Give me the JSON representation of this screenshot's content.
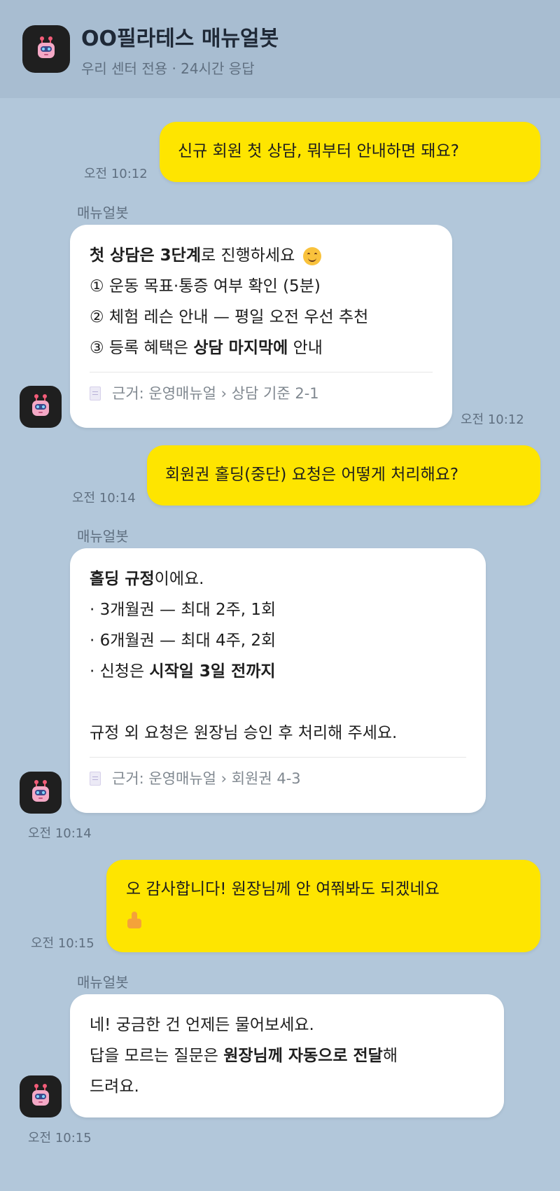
{
  "header": {
    "title": "OO필라테스 매뉴얼봇",
    "subtitle": "우리 센터 전용 · 24시간 응답",
    "avatar_icon": "robot-icon"
  },
  "messages": [
    {
      "from": "user",
      "text": "신규 회원 첫 상담, 뭐부터 안내하면 돼요?",
      "time": "오전 10:12"
    },
    {
      "from": "bot",
      "sender": "매뉴얼봇",
      "time": "오전 10:12",
      "lines": [
        {
          "b1": "첫 상담은 3단계",
          "t1": "로 진행하세요"
        },
        {
          "t1": "① 운동 목표·통증 여부 확인 (5분)"
        },
        {
          "t1": "② 체험 레슨 안내 — 평일 오전 우선 추천"
        },
        {
          "t1": "③ 등록 혜택은 ",
          "b1": "상담 마지막에",
          "t2": " 안내"
        }
      ],
      "source": "근거: 운영매뉴얼 › 상담 기준 2-1"
    },
    {
      "from": "user",
      "text": "회원권 홀딩(중단) 요청은 어떻게 처리해요?",
      "time": "오전 10:14"
    },
    {
      "from": "bot",
      "sender": "매뉴얼봇",
      "time": "오전 10:14",
      "lines": [
        {
          "b1": "홀딩 규정",
          "t1": "이에요."
        },
        {
          "t1": "· 3개월권 — 최대 2주, 1회"
        },
        {
          "t1": "· 6개월권 — 최대 4주, 2회"
        },
        {
          "t1": "· 신청은 ",
          "b1": "시작일 3일 전까지"
        },
        {
          "t1": ""
        },
        {
          "t1": "규정 외 요청은 원장님 승인 후 처리해 주세요."
        }
      ],
      "source": "근거: 운영매뉴얼 › 회원권 4-3"
    },
    {
      "from": "user",
      "text_line1": "오 감사합니다! 원장님께 안 여쭤봐도 되겠네요",
      "time": "오전 10:15"
    },
    {
      "from": "bot",
      "sender": "매뉴얼봇",
      "time": "오전 10:15",
      "lines": [
        {
          "t1": "네! 궁금한 건 언제든 물어보세요."
        },
        {
          "t1": "답을 모르는 질문은 ",
          "b1": "원장님께 자동으로 전달",
          "t2": "해"
        },
        {
          "t1": "드려요."
        }
      ]
    }
  ],
  "icons": {
    "smile": "smiling-face-icon",
    "thumbs": "thumbs-up-icon",
    "doc": "document-icon"
  },
  "colors": {
    "background": "#b2c7da",
    "user_bubble": "#fee500",
    "bot_bubble": "#ffffff"
  }
}
